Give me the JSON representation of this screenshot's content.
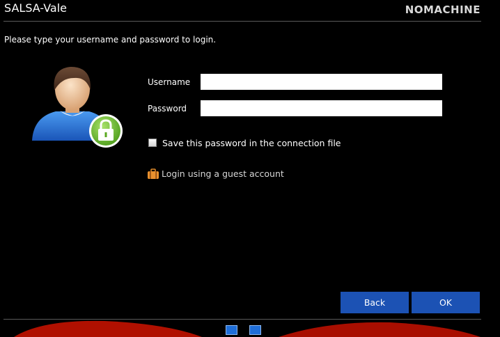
{
  "header": {
    "title": "SALSA-Vale",
    "logo_text": "NOMACHINE"
  },
  "login": {
    "instructions": "Please type your username and password to login.",
    "username_label": "Username",
    "username_value": "",
    "password_label": "Password",
    "password_value": "",
    "save_password_label": "Save this password in the connection file",
    "save_password_checked": false,
    "guest_label": "Login using a guest account"
  },
  "buttons": {
    "back": "Back",
    "ok": "OK"
  },
  "toolbar": {
    "icons": [
      "fullscreen-icon",
      "window-mode-icon"
    ]
  },
  "colors": {
    "background": "#000000",
    "button": "#1c52b4",
    "lock_badge": "#7ac943",
    "decoration_red": "#b01000"
  }
}
